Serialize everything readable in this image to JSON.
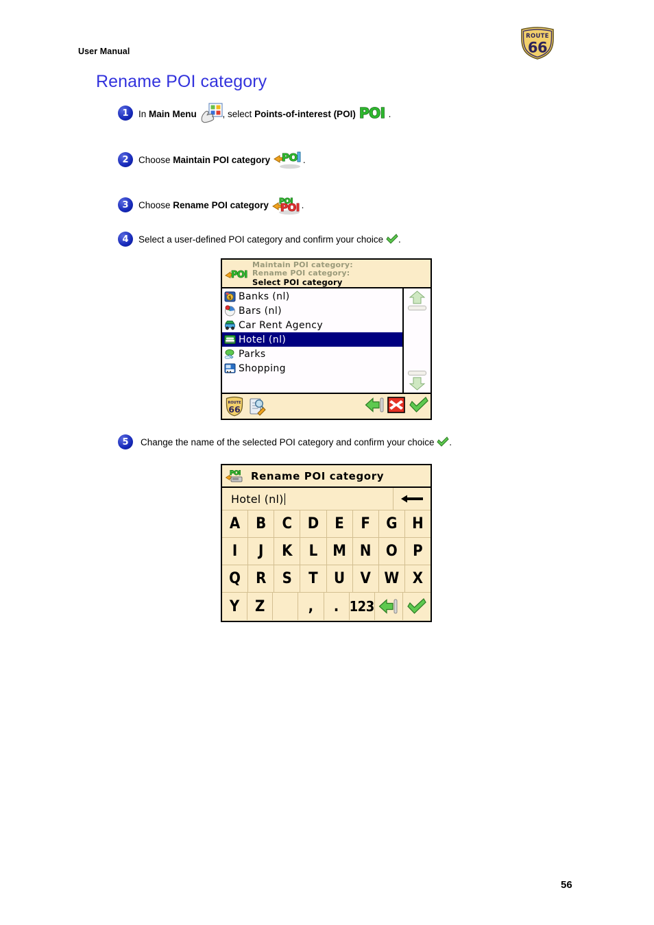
{
  "header": {
    "manual_label": "User Manual",
    "logo_top_text": "ROUTE",
    "logo_number": "66"
  },
  "page": {
    "title": "Rename POI category",
    "number": "56",
    "title_color": "#3333dd"
  },
  "steps": [
    {
      "num": "1",
      "prefix": "In ",
      "bold1": "Main Menu",
      "icon1": "main-menu-icon",
      "middle": ", select ",
      "bold2": "Points-of-interest (POI)",
      "icon2": "poi-green-icon",
      "suffix": "."
    },
    {
      "num": "2",
      "prefix": "Choose ",
      "bold1": "Maintain POI category",
      "icon1": "maintain-poi-category-icon",
      "suffix": "."
    },
    {
      "num": "3",
      "prefix": "Choose ",
      "bold1": "Rename POI category",
      "icon1": "rename-poi-category-icon",
      "suffix": "."
    },
    {
      "num": "4",
      "prefix": "Select a user-defined POI category and confirm your choice ",
      "icon1": "green-check-icon",
      "suffix": "."
    },
    {
      "num": "5",
      "prefix": "Change the name of the selected POI category and confirm your choice ",
      "icon1": "green-check-icon",
      "suffix": "."
    }
  ],
  "device_select": {
    "breadcrumb_1": "Maintain POI category:",
    "breadcrumb_2": "Rename POI category:",
    "current_screen": "Select POI category",
    "header_icon": "poi-category-icon",
    "selected_color": "#000080",
    "list": [
      {
        "label": "Banks  (nl)",
        "icon": "bank-icon",
        "selected": false
      },
      {
        "label": "Bars  (nl)",
        "icon": "bar-drink-icon",
        "selected": false
      },
      {
        "label": "Car  Rent  Agency",
        "icon": "car-rental-icon",
        "selected": false
      },
      {
        "label": "Hotel (nl)",
        "icon": "hotel-bed-icon",
        "selected": true
      },
      {
        "label": "Parks",
        "icon": "park-tree-icon",
        "selected": false
      },
      {
        "label": "Shopping",
        "icon": "shopping-cart-icon",
        "selected": false
      }
    ],
    "toolbar": {
      "logo": "route66-logo-icon",
      "search": "search-edit-icon",
      "back": "back-arrow-icon",
      "cancel": "cancel-cross-icon",
      "confirm": "confirm-check-icon"
    },
    "scrollbar": {
      "up": "scroll-up-arrow-icon",
      "down": "scroll-down-arrow-icon"
    }
  },
  "device_keyboard": {
    "header_icon": "rename-poi-category-icon",
    "title": "Rename POI category",
    "input_value": "Hotel (nl)",
    "backspace_icon": "backspace-arrow-icon",
    "keys": [
      [
        "A",
        "B",
        "C",
        "D",
        "E",
        "F",
        "G",
        "H"
      ],
      [
        "I",
        "J",
        "K",
        "L",
        "M",
        "N",
        "O",
        "P"
      ],
      [
        "Q",
        "R",
        "S",
        "T",
        "U",
        "V",
        "W",
        "X"
      ]
    ],
    "last_row": [
      {
        "label": "Y",
        "type": "char"
      },
      {
        "label": "Z",
        "type": "char"
      },
      {
        "label": "",
        "type": "space"
      },
      {
        "label": ",",
        "type": "char"
      },
      {
        "label": ".",
        "type": "char"
      },
      {
        "label": "123",
        "type": "numeric-mode"
      },
      {
        "label": "",
        "type": "back-arrow-icon"
      },
      {
        "label": "",
        "type": "confirm-check-icon"
      }
    ]
  }
}
